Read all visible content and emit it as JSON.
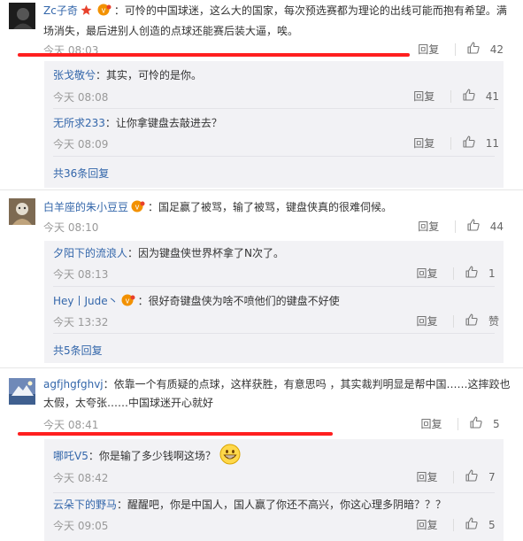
{
  "colors": {
    "link": "#3366aa",
    "text": "#333333",
    "meta": "#999999",
    "reply_bg": "#f2f2f5",
    "highlight_line": "#ff1f1f",
    "star": "#e8412c",
    "badge": "#f29100"
  },
  "comments": [
    {
      "user": "Zc子奇",
      "text": "：可怜的中国球迷，这么大的国家，每次预选赛都为理论的出线可能而抱有希望。满场消失，最后进别人创造的点球还能赛后装大逼，唉。",
      "time": "今天 08:03",
      "reply_label": "回复",
      "likes": "42",
      "replies": [
        {
          "user": "张戈敬兮",
          "text": "：其实，可怜的是你。",
          "time": "今天 08:08",
          "reply_label": "回复",
          "likes": "41"
        },
        {
          "user": "无所求233",
          "text": "：让你拿键盘去敲进去？",
          "time": "今天 08:09",
          "reply_label": "回复",
          "likes": "11"
        }
      ],
      "more_replies": "共36条回复"
    },
    {
      "user": "白羊座的朱小豆豆",
      "text": "：国足赢了被骂，输了被骂，键盘侠真的很难伺候。",
      "time": "今天 08:10",
      "reply_label": "回复",
      "likes": "44",
      "replies": [
        {
          "user": "夕阳下的流浪人",
          "text": "：因为键盘侠世界杯拿了N次了。",
          "time": "今天 08:13",
          "reply_label": "回复",
          "likes": "1"
        },
        {
          "user": "Hey丨Jude丶",
          "text": "：很好奇键盘侠为啥不喷他们的键盘不好使",
          "time": "今天 13:32",
          "reply_label": "回复",
          "likes": "赞"
        }
      ],
      "more_replies": "共5条回复"
    },
    {
      "user": "agfjhgfghvj",
      "text": "：依靠一个有质疑的点球，这样获胜，有意思吗 ，其实裁判明显是帮中国……这摔跤也太假，太夸张……中国球迷开心就好",
      "time": "今天 08:41",
      "reply_label": "回复",
      "likes": "5",
      "replies": [
        {
          "user": "哪吒V5",
          "text": "：你是输了多少钱啊这场？",
          "time": "今天 08:42",
          "reply_label": "回复",
          "likes": "7"
        },
        {
          "user": "云朵下的野马",
          "text": "：醒醒吧，你是中国人，国人赢了你还不高兴，你这心理多阴暗？？？",
          "time": "今天 09:05",
          "reply_label": "回复",
          "likes": "5"
        }
      ]
    }
  ]
}
